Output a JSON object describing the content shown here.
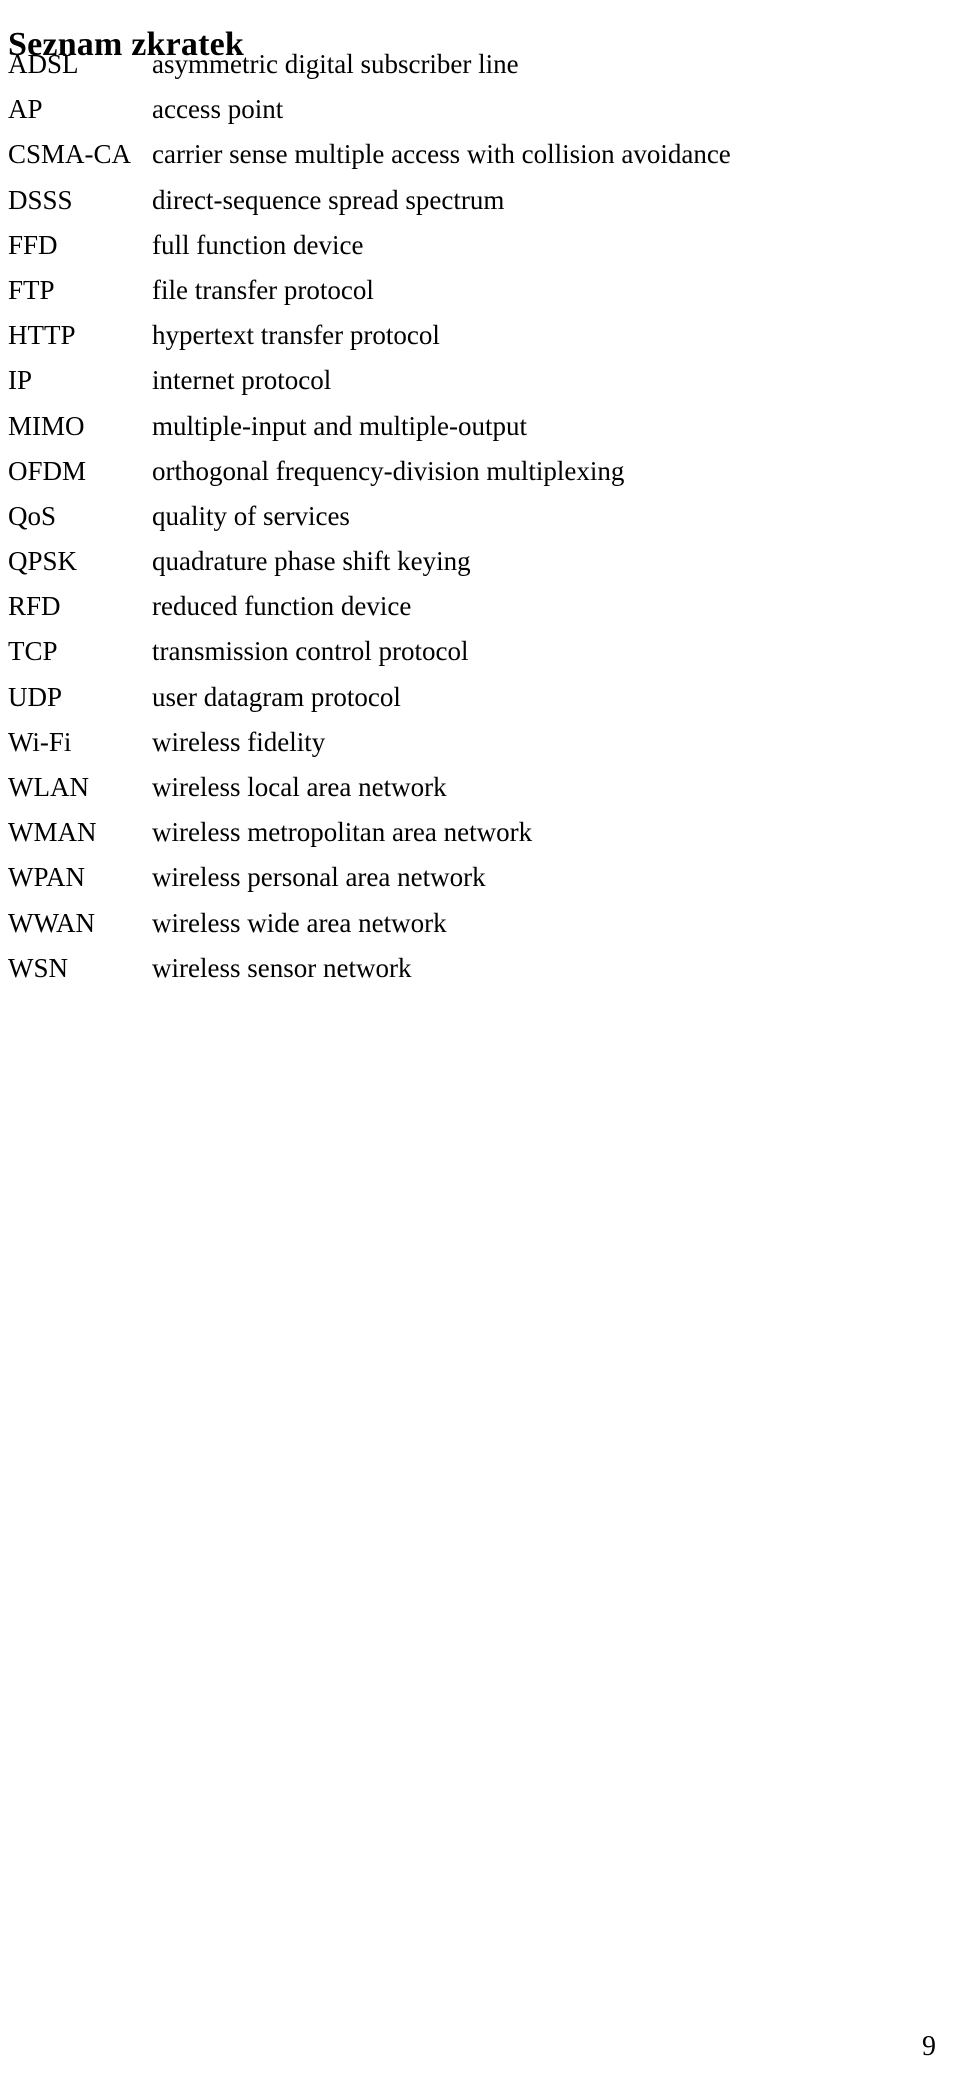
{
  "document": {
    "title": "Seznam zkratek",
    "page_number": "9",
    "abbreviations": [
      {
        "term": "ADSL",
        "definition": "asymmetric digital subscriber line"
      },
      {
        "term": "AP",
        "definition": "access point"
      },
      {
        "term": "CSMA-CA",
        "definition": "carrier sense multiple access with collision avoidance"
      },
      {
        "term": "DSSS",
        "definition": "direct-sequence spread spectrum"
      },
      {
        "term": "FFD",
        "definition": "full function device"
      },
      {
        "term": "FTP",
        "definition": "file transfer protocol"
      },
      {
        "term": "HTTP",
        "definition": "hypertext transfer protocol"
      },
      {
        "term": "IP",
        "definition": "internet protocol"
      },
      {
        "term": "MIMO",
        "definition": "multiple-input and multiple-output"
      },
      {
        "term": "OFDM",
        "definition": "orthogonal frequency-division multiplexing"
      },
      {
        "term": "QoS",
        "definition": "quality of services"
      },
      {
        "term": "QPSK",
        "definition": "quadrature phase shift keying"
      },
      {
        "term": "RFD",
        "definition": "reduced function device"
      },
      {
        "term": "TCP",
        "definition": "transmission control protocol"
      },
      {
        "term": "UDP",
        "definition": "user datagram protocol"
      },
      {
        "term": "Wi-Fi",
        "definition": "wireless fidelity"
      },
      {
        "term": "WLAN",
        "definition": "wireless local area network"
      },
      {
        "term": "WMAN",
        "definition": "wireless metropolitan area network"
      },
      {
        "term": "WPAN",
        "definition": "wireless personal area network"
      },
      {
        "term": "WWAN",
        "definition": "wireless wide area network"
      },
      {
        "term": "WSN",
        "definition": "wireless sensor network"
      }
    ]
  }
}
